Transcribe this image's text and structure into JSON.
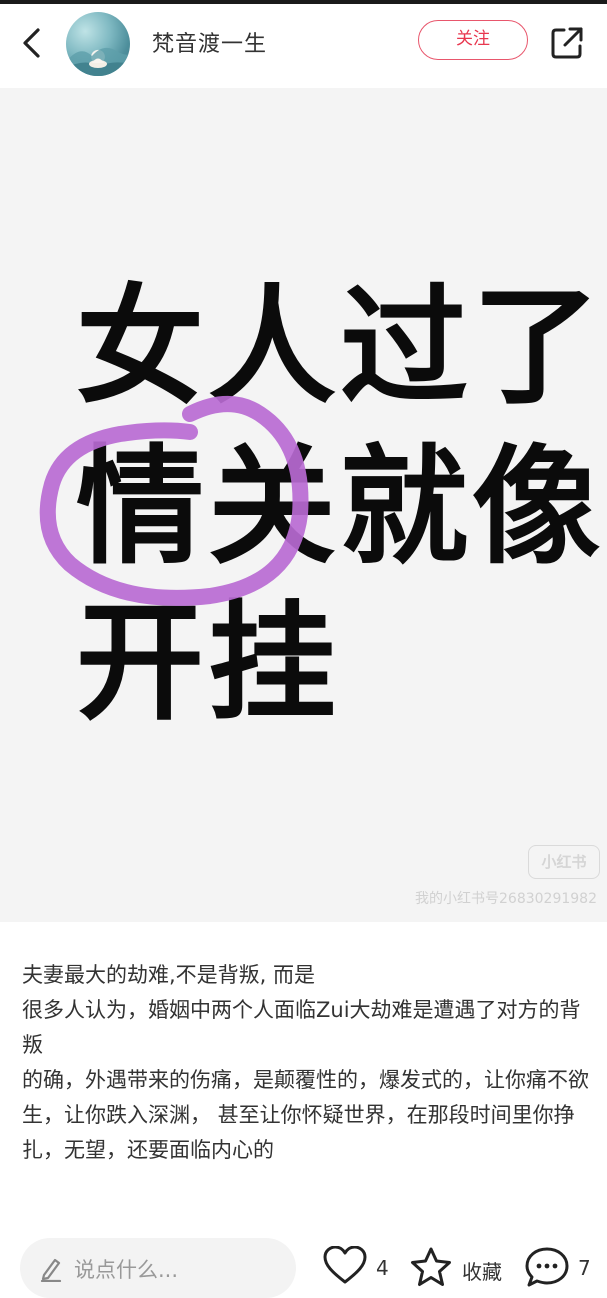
{
  "header": {
    "author_name": "梵音渡一生",
    "follow_label": "关注"
  },
  "cover": {
    "lines": [
      "女人过了",
      "情关就像",
      "开挂"
    ],
    "watermark_logo": "小红书",
    "watermark_id": "我的小红书号26830291982"
  },
  "content": {
    "paragraphs": [
      "夫妻最大的劫难,不是背叛, 而是",
      "很多人认为，婚姻中两个人面临Zui大劫难是遭遇了对方的背叛",
      "的确，外遇带来的伤痛，是颠覆性的，爆发式的，让你痛不欲生，让你跌入深渊， 甚至让你怀疑世界，在那段时间里你挣扎，无望，还要面临内心的"
    ]
  },
  "bottom_bar": {
    "comment_placeholder": "说点什么...",
    "like_count": "4",
    "collect_label": "收藏",
    "comment_count": "7"
  },
  "colors": {
    "accent": "#e8374f",
    "circle_mark": "#b86ad2"
  }
}
